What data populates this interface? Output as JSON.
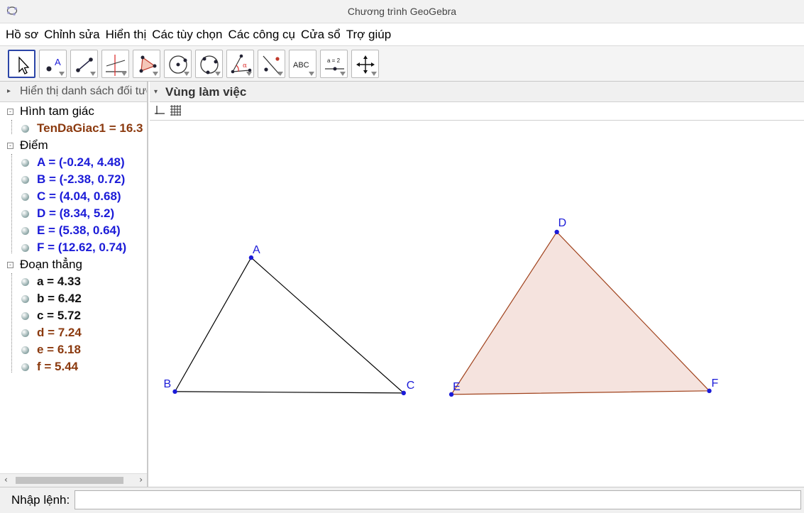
{
  "window": {
    "title": "Chương trình GeoGebra"
  },
  "menu": [
    "Hồ sơ",
    "Chỉnh sửa",
    "Hiển thị",
    "Các tùy chọn",
    "Các công cụ",
    "Cửa sổ",
    "Trợ giúp"
  ],
  "toolbar": {
    "tools": [
      {
        "name": "move-tool",
        "icon": "pointer-icon",
        "selected": true
      },
      {
        "name": "point-tool",
        "icon": "point-icon",
        "text": "A"
      },
      {
        "name": "line-tool",
        "icon": "line-icon"
      },
      {
        "name": "perpendicular-tool",
        "icon": "perpendicular-line-icon"
      },
      {
        "name": "polygon-tool",
        "icon": "polygon-icon"
      },
      {
        "name": "circle-tool",
        "icon": "circle-center-icon"
      },
      {
        "name": "circle-3points-tool",
        "icon": "circle-three-points-icon"
      },
      {
        "name": "angle-tool",
        "icon": "angle-icon",
        "text": "α"
      },
      {
        "name": "reflect-tool",
        "icon": "reflect-icon"
      },
      {
        "name": "text-tool",
        "icon": "text-icon",
        "text": "ABC"
      },
      {
        "name": "slider-tool",
        "icon": "slider-icon",
        "text": "a = 2"
      },
      {
        "name": "move-view-tool",
        "icon": "move-graphics-icon"
      }
    ]
  },
  "algebra": {
    "header": "Hiển thị danh sách đối tượng",
    "categories": [
      {
        "label": "Hình tam giác",
        "items": [
          {
            "text": "TenDaGiac1 = 16.3",
            "color": "brown"
          }
        ]
      },
      {
        "label": "Điểm",
        "items": [
          {
            "text": "A = (-0.24, 4.48)",
            "color": "blue"
          },
          {
            "text": "B = (-2.38, 0.72)",
            "color": "blue"
          },
          {
            "text": "C = (4.04, 0.68)",
            "color": "blue"
          },
          {
            "text": "D = (8.34, 5.2)",
            "color": "blue"
          },
          {
            "text": "E = (5.38, 0.64)",
            "color": "blue"
          },
          {
            "text": "F = (12.62, 0.74)",
            "color": "blue"
          }
        ]
      },
      {
        "label": "Đoạn thẳng",
        "items": [
          {
            "text": "a = 4.33",
            "color": "black"
          },
          {
            "text": "b = 6.42",
            "color": "black"
          },
          {
            "text": "c = 5.72",
            "color": "black"
          },
          {
            "text": "d = 7.24",
            "color": "brown"
          },
          {
            "text": "e = 6.18",
            "color": "brown"
          },
          {
            "text": "f = 5.44",
            "color": "brown"
          }
        ]
      }
    ]
  },
  "graphics": {
    "header": "Vùng làm việc",
    "points": [
      {
        "label": "A",
        "x": -0.24,
        "y": 4.48
      },
      {
        "label": "B",
        "x": -2.38,
        "y": 0.72
      },
      {
        "label": "C",
        "x": 4.04,
        "y": 0.68
      },
      {
        "label": "D",
        "x": 8.34,
        "y": 5.2
      },
      {
        "label": "E",
        "x": 5.38,
        "y": 0.64
      },
      {
        "label": "F",
        "x": 12.62,
        "y": 0.74
      }
    ],
    "colors": {
      "point": "#1b1bd8",
      "triangle1": "#000000",
      "triangle2_stroke": "#a0421c",
      "triangle2_fill": "#f5e3de"
    }
  },
  "input": {
    "label": "Nhập lệnh:",
    "value": ""
  }
}
